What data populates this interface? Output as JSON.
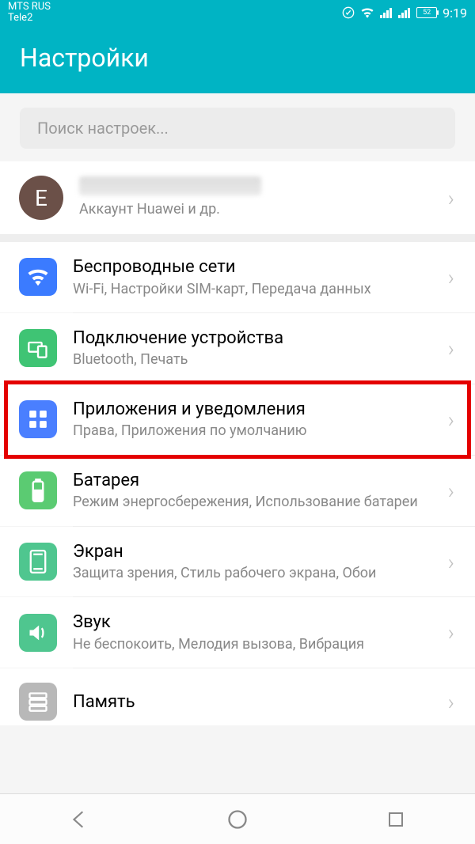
{
  "status": {
    "carrier1": "MTS RUS",
    "carrier2": "Tele2",
    "battery": "52",
    "time": "9:19"
  },
  "header": {
    "title": "Настройки"
  },
  "search": {
    "placeholder": "Поиск настроек..."
  },
  "account": {
    "avatar_letter": "E",
    "subtitle": "Аккаунт Huawei и др."
  },
  "items": [
    {
      "title": "Беспроводные сети",
      "subtitle": "Wi-Fi, Настройки SIM-карт, Передача данных"
    },
    {
      "title": "Подключение устройства",
      "subtitle": "Bluetooth, Печать"
    },
    {
      "title": "Приложения и уведомления",
      "subtitle": "Права, Приложения по умолчанию"
    },
    {
      "title": "Батарея",
      "subtitle": "Режим энергосбережения, Использование батареи"
    },
    {
      "title": "Экран",
      "subtitle": "Защита зрения, Стиль рабочего экрана, Обои"
    },
    {
      "title": "Звук",
      "subtitle": "Не беспокоить, Мелодия вызова, Вибрация"
    },
    {
      "title": "Память",
      "subtitle": ""
    }
  ]
}
